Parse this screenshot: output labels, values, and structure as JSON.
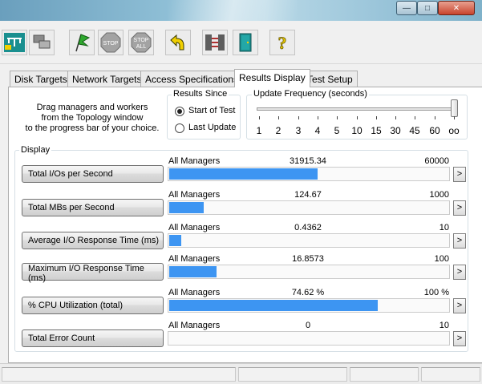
{
  "window": {
    "minimize_glyph": "—",
    "maximize_glyph": "□",
    "close_glyph": "✕"
  },
  "toolbar": {
    "buttons": [
      {
        "id": "topology",
        "icon": "network-topology-icon",
        "color": "#1a8f8f"
      },
      {
        "id": "new-manager",
        "icon": "computer-workers-icon",
        "color": "#7a7a7a"
      },
      {
        "id": "start",
        "icon": "green-flag-icon",
        "color": "#2e9e2e"
      },
      {
        "id": "stop",
        "icon": "stop-sign-icon",
        "label": "STOP",
        "color": "#9a9a9a"
      },
      {
        "id": "stop-all",
        "icon": "stop-all-icon",
        "label": "STOP\nALL",
        "color": "#9a9a9a"
      },
      {
        "id": "reset",
        "icon": "reset-arrow-icon",
        "color": "#d8b400"
      },
      {
        "id": "disconnect",
        "icon": "disconnect-icon",
        "color": "#b03030"
      },
      {
        "id": "exit",
        "icon": "exit-door-icon",
        "color": "#1a8f8f"
      },
      {
        "id": "help",
        "icon": "help-question-icon",
        "label": "?",
        "color": "#e6c800"
      }
    ]
  },
  "tabs": [
    {
      "label": "Disk Targets",
      "active": false
    },
    {
      "label": "Network Targets",
      "active": false
    },
    {
      "label": "Access Specifications",
      "active": false
    },
    {
      "label": "Results Display",
      "active": true
    },
    {
      "label": "Test Setup",
      "active": false
    }
  ],
  "drag_hint": [
    "Drag managers and workers",
    "from the Topology window",
    "to the progress bar of your choice."
  ],
  "results_since": {
    "legend": "Results Since",
    "options": [
      {
        "label": "Start of Test",
        "selected": true
      },
      {
        "label": "Last Update",
        "selected": false
      }
    ]
  },
  "update_frequency": {
    "legend": "Update Frequency (seconds)",
    "ticks": [
      "1",
      "2",
      "3",
      "4",
      "5",
      "10",
      "15",
      "30",
      "45",
      "60",
      "oo"
    ],
    "selected_index": 10
  },
  "display": {
    "legend": "Display",
    "expand_glyph": ">",
    "accent_color": "#3d95f2",
    "metrics": [
      {
        "label": "Total I/Os per Second",
        "target": "All Managers",
        "value": "31915.34",
        "max": "60000",
        "fraction": 0.5319
      },
      {
        "label": "Total MBs per Second",
        "target": "All Managers",
        "value": "124.67",
        "max": "1000",
        "fraction": 0.1247
      },
      {
        "label": "Average I/O Response Time (ms)",
        "target": "All Managers",
        "value": "0.4362",
        "max": "10",
        "fraction": 0.0436
      },
      {
        "label": "Maximum I/O Response Time (ms)",
        "target": "All Managers",
        "value": "16.8573",
        "max": "100",
        "fraction": 0.1686
      },
      {
        "label": "% CPU Utilization (total)",
        "target": "All Managers",
        "value": "74.62 %",
        "max": "100 %",
        "fraction": 0.7462
      },
      {
        "label": "Total Error Count",
        "target": "All Managers",
        "value": "0",
        "max": "10",
        "fraction": 0
      }
    ]
  }
}
